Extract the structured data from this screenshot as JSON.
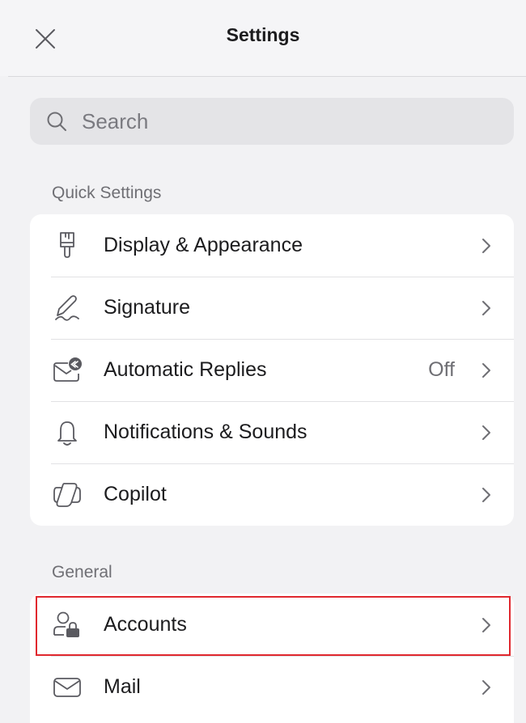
{
  "header": {
    "title": "Settings",
    "close_icon": "close-icon"
  },
  "search": {
    "placeholder": "Search",
    "icon": "search-icon"
  },
  "sections": [
    {
      "label": "Quick Settings",
      "items": [
        {
          "label": "Display & Appearance",
          "icon": "brush-icon",
          "value": ""
        },
        {
          "label": "Signature",
          "icon": "signature-icon",
          "value": ""
        },
        {
          "label": "Automatic Replies",
          "icon": "automatic-reply-icon",
          "value": "Off"
        },
        {
          "label": "Notifications & Sounds",
          "icon": "bell-icon",
          "value": ""
        },
        {
          "label": "Copilot",
          "icon": "copilot-icon",
          "value": ""
        }
      ]
    },
    {
      "label": "General",
      "items": [
        {
          "label": "Accounts",
          "icon": "account-lock-icon",
          "value": "",
          "highlighted": true
        },
        {
          "label": "Mail",
          "icon": "mail-icon",
          "value": ""
        }
      ]
    }
  ],
  "colors": {
    "background": "#f2f2f4",
    "card": "#ffffff",
    "text": "#1c1c1e",
    "secondary_text": "#6f6f74",
    "icon_stroke": "#5a5a60",
    "highlight_border": "#e0282e"
  }
}
